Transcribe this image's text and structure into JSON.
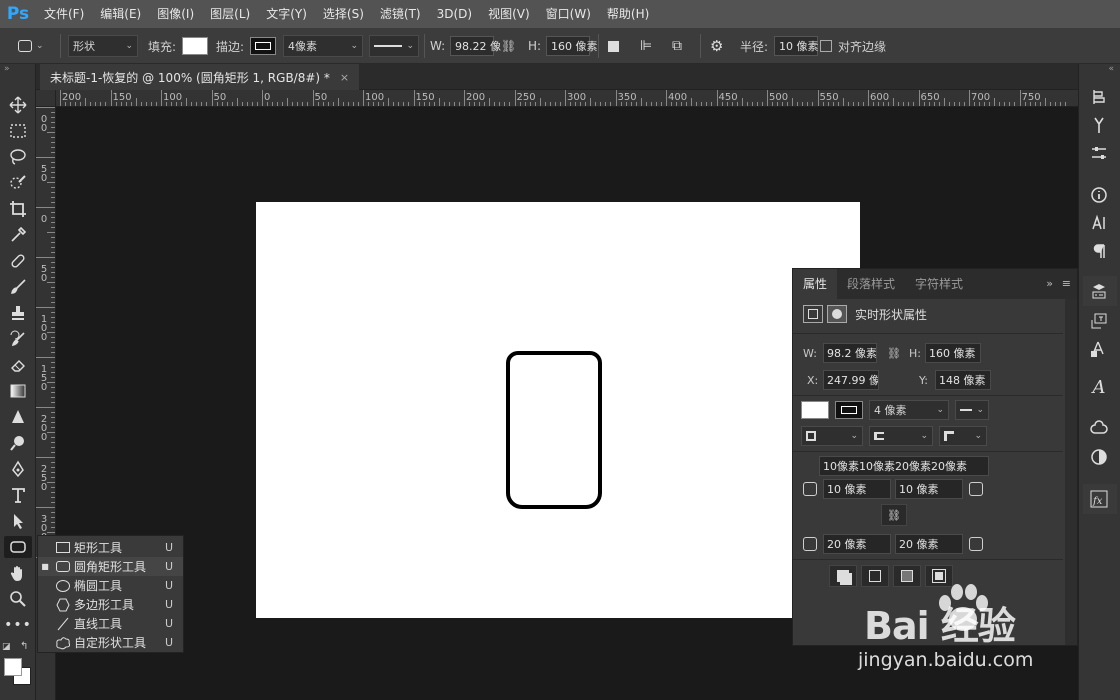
{
  "app": {
    "logo": "Ps"
  },
  "menu": [
    "文件(F)",
    "编辑(E)",
    "图像(I)",
    "图层(L)",
    "文字(Y)",
    "选择(S)",
    "滤镜(T)",
    "3D(D)",
    "视图(V)",
    "窗口(W)",
    "帮助(H)"
  ],
  "options": {
    "mode": "形状",
    "fill_label": "填充:",
    "stroke_label": "描边:",
    "stroke_width": "4像素",
    "w_label": "W:",
    "w_value": "98.22 像",
    "h_label": "H:",
    "h_value": "160 像素",
    "radius_label": "半径:",
    "radius_value": "10 像素",
    "align_edges_label": "对齐边缘"
  },
  "document_tab": {
    "title": "未标题-1-恢复的 @ 100% (圆角矩形 1, RGB/8#) *",
    "close": "×"
  },
  "ruler_top_labels": [
    "200",
    "150",
    "100",
    "50",
    "0",
    "50",
    "100",
    "150",
    "200",
    "250",
    "300",
    "350",
    "400",
    "450",
    "500",
    "550",
    "600",
    "650",
    "700",
    "750"
  ],
  "ruler_left_labels": [
    [
      "0",
      "0"
    ],
    [
      "5",
      "0"
    ],
    [
      "0"
    ],
    [
      "5",
      "0"
    ],
    [
      "1",
      "0",
      "0"
    ],
    [
      "1",
      "5",
      "0"
    ],
    [
      "2",
      "0",
      "0"
    ],
    [
      "2",
      "5",
      "0"
    ],
    [
      "3",
      "0",
      "0"
    ],
    [
      "3",
      "5",
      "0"
    ]
  ],
  "tool_flyout": [
    {
      "label": "矩形工具",
      "key": "U",
      "icon": "rectangle-icon",
      "selected": false
    },
    {
      "label": "圆角矩形工具",
      "key": "U",
      "icon": "rounded-rectangle-icon",
      "selected": true
    },
    {
      "label": "椭圆工具",
      "key": "U",
      "icon": "ellipse-icon",
      "selected": false
    },
    {
      "label": "多边形工具",
      "key": "U",
      "icon": "polygon-icon",
      "selected": false
    },
    {
      "label": "直线工具",
      "key": "U",
      "icon": "line-icon",
      "selected": false
    },
    {
      "label": "自定形状工具",
      "key": "U",
      "icon": "custom-shape-icon",
      "selected": false
    }
  ],
  "properties": {
    "tabs": [
      "属性",
      "段落样式",
      "字符样式"
    ],
    "active_tab": "属性",
    "section_title": "实时形状属性",
    "w_label": "W:",
    "w_value": "98.2 像素",
    "h_label": "H:",
    "h_value": "160 像素",
    "x_label": "X:",
    "x_value": "247.99 像",
    "y_label": "Y:",
    "y_value": "148 像素",
    "stroke_width": "4 像素",
    "radii_summary": "10像素10像素20像素20像素",
    "corner_tl": "10 像素",
    "corner_tr": "10 像素",
    "corner_bl": "20 像素",
    "corner_br": "20 像素"
  },
  "watermark": {
    "brand": "Bai 经验",
    "url": "jingyan.baidu.com"
  }
}
